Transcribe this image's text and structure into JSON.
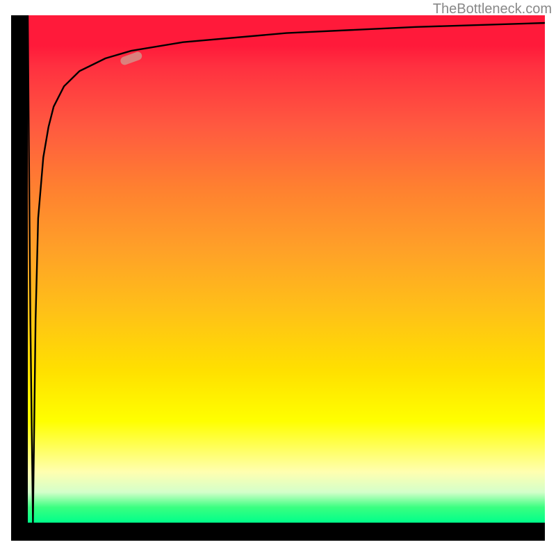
{
  "attribution": "TheBottleneck.com",
  "chart_data": {
    "type": "line",
    "title": "",
    "xlabel": "",
    "ylabel": "",
    "xlim": [
      0,
      100
    ],
    "ylim": [
      0,
      100
    ],
    "grid": false,
    "series": [
      {
        "name": "curve",
        "x": [
          0,
          0.5,
          1.0,
          1.5,
          2,
          3,
          4,
          5,
          7,
          10,
          15,
          20,
          30,
          50,
          75,
          100
        ],
        "values": [
          100,
          40,
          0,
          40,
          60,
          72,
          78,
          82,
          86,
          89,
          91.5,
          93,
          94.7,
          96.5,
          97.7,
          98.5
        ]
      }
    ],
    "highlight_marker": {
      "x": 20,
      "y": 91.5,
      "angle": -20,
      "color": "#d59088"
    },
    "gradient_stops": [
      {
        "pos": 0,
        "color": "#ff1a3a"
      },
      {
        "pos": 35,
        "color": "#ff8030"
      },
      {
        "pos": 70,
        "color": "#ffe000"
      },
      {
        "pos": 90,
        "color": "#ffffb0"
      },
      {
        "pos": 100,
        "color": "#00ff8a"
      }
    ]
  }
}
